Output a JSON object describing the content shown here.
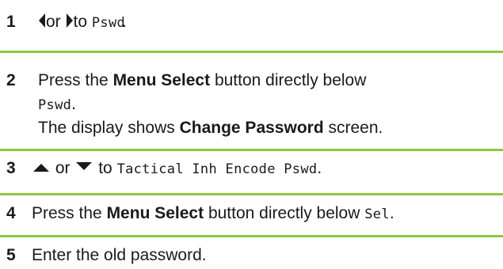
{
  "steps": [
    {
      "number": "1",
      "or_word": "or",
      "to_word": "to",
      "target": "Pswd",
      "end": "."
    },
    {
      "number": "2",
      "line1_pre": "Press the",
      "line1_bold": "Menu Select",
      "line1_post": "button directly below",
      "line2_mono": "Pswd",
      "line2_end": ".",
      "line3_pre": "The display shows",
      "line3_bold": "Change Password",
      "line3_post": "screen."
    },
    {
      "number": "3",
      "or_word": "or",
      "to_word": "to",
      "target": "Tactical Inh Encode Pswd",
      "end": "."
    },
    {
      "number": "4",
      "pre": "Press the",
      "bold": "Menu Select",
      "post": "button directly below",
      "mono": "Sel",
      "end": "."
    },
    {
      "number": "5",
      "text": "Enter the old password."
    }
  ],
  "colors": {
    "rule": "#8dc63f",
    "text": "#1a1a1a"
  },
  "icons": {
    "left": "left-arrow-icon",
    "right": "right-arrow-icon",
    "up": "up-arrow-icon",
    "down": "down-arrow-icon"
  }
}
